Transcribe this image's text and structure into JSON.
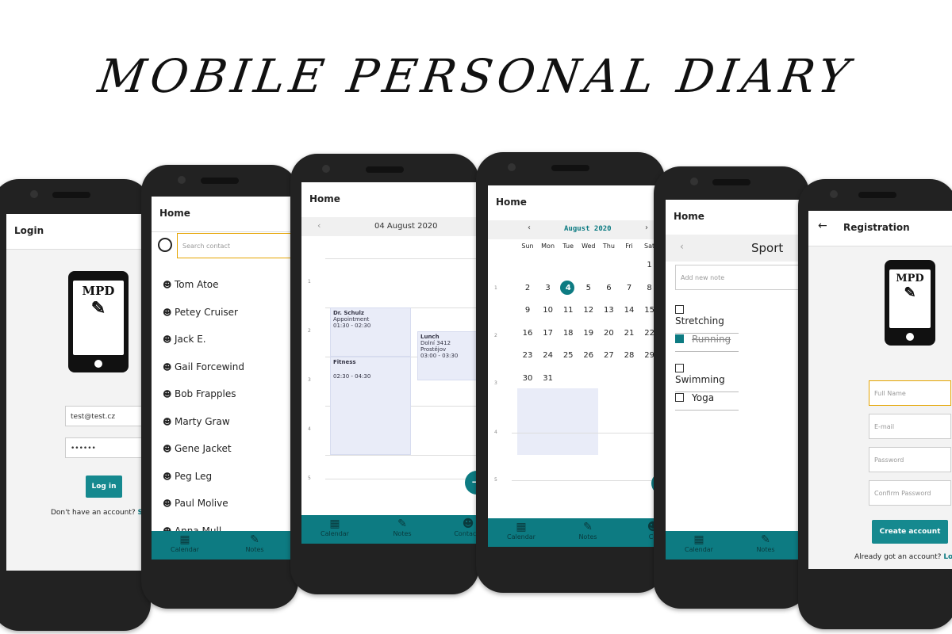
{
  "title": "MOBILE PERSONAL DIARY",
  "logo_text": "MPD",
  "login": {
    "header": "Login",
    "email_value": "test@test.cz",
    "password_value": "••••••",
    "login_button": "Log in",
    "no_account_text": "Don't have an account?",
    "sign_up_link": "Si"
  },
  "contacts": {
    "header": "Home",
    "search_placeholder": "Search contact",
    "list": [
      "Tom Atoe",
      "Petey Cruiser",
      "Jack E.",
      "Gail Forcewind",
      "Bob Frapples",
      "Marty Graw",
      "Gene Jacket",
      "Peg Leg",
      "Paul Molive",
      "Anna Mull"
    ],
    "tabs": [
      "Calendar",
      "Notes"
    ]
  },
  "day_view": {
    "header": "Home",
    "date": "04 August 2020",
    "hours": [
      "1",
      "2",
      "3",
      "4",
      "5"
    ],
    "events": [
      {
        "title": "Dr. Schulz",
        "subtitle": "Appointment",
        "time": "01:30 - 02:30"
      },
      {
        "title": "Lunch",
        "subtitle": "Dolní 3412 Prostějov",
        "time": "03:00 - 03:30"
      },
      {
        "title": "Fitness",
        "subtitle": "",
        "time": "02:30 - 04:30"
      }
    ],
    "tabs": [
      "Calendar",
      "Notes",
      "Contacts"
    ]
  },
  "month_view": {
    "header": "Home",
    "month": "August 2020",
    "weekdays": [
      "Sun",
      "Mon",
      "Tue",
      "Wed",
      "Thu",
      "Fri",
      "Sat"
    ],
    "days": [
      [
        "",
        "",
        "",
        "",
        "",
        "",
        "1"
      ],
      [
        "2",
        "3",
        "4",
        "5",
        "6",
        "7",
        "8"
      ],
      [
        "9",
        "10",
        "11",
        "12",
        "13",
        "14",
        "15"
      ],
      [
        "16",
        "17",
        "18",
        "19",
        "20",
        "21",
        "22"
      ],
      [
        "23",
        "24",
        "25",
        "26",
        "27",
        "28",
        "29"
      ],
      [
        "30",
        "31",
        "",
        "",
        "",
        "",
        ""
      ]
    ],
    "selected_day": "4",
    "hours": [
      "1",
      "2",
      "3",
      "4",
      "5"
    ],
    "tabs": [
      "Calendar",
      "Notes",
      "Co"
    ]
  },
  "notes": {
    "header": "Home",
    "category": "Sport",
    "add_placeholder": "Add new note",
    "items": [
      {
        "label": "Stretching",
        "checked": false
      },
      {
        "label": "Running",
        "checked": true
      },
      {
        "label": "Swimming",
        "checked": false
      },
      {
        "label": "Yoga",
        "checked": false
      }
    ],
    "tabs": [
      "Calendar",
      "Notes"
    ]
  },
  "registration": {
    "header": "Registration",
    "full_name_placeholder": "Full Name",
    "email_placeholder": "E-mail",
    "password_placeholder": "Password",
    "confirm_placeholder": "Confirm Password",
    "create_button": "Create account",
    "have_account_text": "Already got an account?",
    "login_link": "Log"
  },
  "colors": {
    "accent": "#0d7b82",
    "button": "#15898f",
    "event_bg": "#e9ecf8"
  }
}
